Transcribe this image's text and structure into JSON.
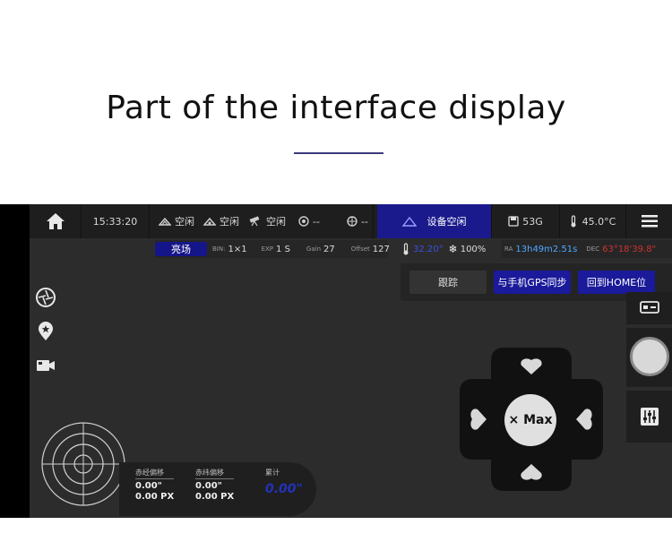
{
  "headline": "Part of the interface display",
  "topbar": {
    "time": "15:33:20",
    "device1": "空闲",
    "device2": "空闲",
    "device3": "空闲",
    "device4": "--",
    "device5": "--",
    "status": "设备空闲",
    "storage": "53G",
    "temperature": "45.0°C"
  },
  "subbar": {
    "mode": "亮场",
    "bin_label": "BIN:",
    "bin": "1×1",
    "exp_label": "EXP",
    "exp": "1 S",
    "gain_label": "Gain",
    "gain": "27",
    "offset_label": "Offset",
    "offset": "127",
    "sensor_temp": "32.20°",
    "cooler": "100%",
    "ra_label": "RA",
    "ra": "13h49m2.51s",
    "dec_label": "DEC",
    "dec": "63°18'39.8\""
  },
  "commands": {
    "track": "跟踪",
    "gps_sync": "与手机GPS同步",
    "home": "回到HOME位"
  },
  "dpad": {
    "speed": "× Max"
  },
  "offset": {
    "ra_label": "赤经偏移",
    "ra_arc": "0.00\"",
    "ra_px": "0.00 PX",
    "dec_label": "赤纬偏移",
    "dec_arc": "0.00\"",
    "dec_px": "0.00 PX",
    "total_label": "累计",
    "total": "0.00\""
  },
  "colors": {
    "accent": "#1a1a9a",
    "screen_bg": "#2c2c2c",
    "bar_bg": "#1e1e1e"
  }
}
